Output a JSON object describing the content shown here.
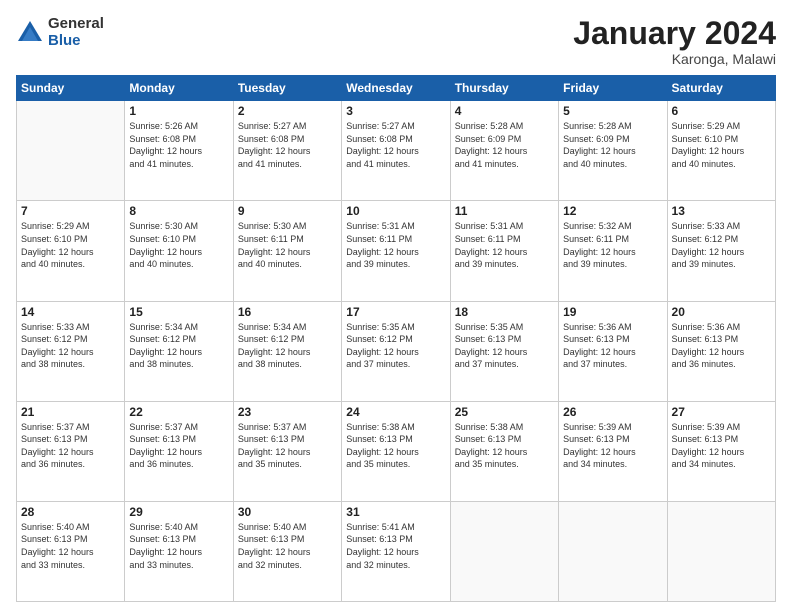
{
  "logo": {
    "general": "General",
    "blue": "Blue"
  },
  "title": "January 2024",
  "subtitle": "Karonga, Malawi",
  "days_header": [
    "Sunday",
    "Monday",
    "Tuesday",
    "Wednesday",
    "Thursday",
    "Friday",
    "Saturday"
  ],
  "weeks": [
    [
      {
        "day": "",
        "info": ""
      },
      {
        "day": "1",
        "info": "Sunrise: 5:26 AM\nSunset: 6:08 PM\nDaylight: 12 hours\nand 41 minutes."
      },
      {
        "day": "2",
        "info": "Sunrise: 5:27 AM\nSunset: 6:08 PM\nDaylight: 12 hours\nand 41 minutes."
      },
      {
        "day": "3",
        "info": "Sunrise: 5:27 AM\nSunset: 6:08 PM\nDaylight: 12 hours\nand 41 minutes."
      },
      {
        "day": "4",
        "info": "Sunrise: 5:28 AM\nSunset: 6:09 PM\nDaylight: 12 hours\nand 41 minutes."
      },
      {
        "day": "5",
        "info": "Sunrise: 5:28 AM\nSunset: 6:09 PM\nDaylight: 12 hours\nand 40 minutes."
      },
      {
        "day": "6",
        "info": "Sunrise: 5:29 AM\nSunset: 6:10 PM\nDaylight: 12 hours\nand 40 minutes."
      }
    ],
    [
      {
        "day": "7",
        "info": "Sunrise: 5:29 AM\nSunset: 6:10 PM\nDaylight: 12 hours\nand 40 minutes."
      },
      {
        "day": "8",
        "info": "Sunrise: 5:30 AM\nSunset: 6:10 PM\nDaylight: 12 hours\nand 40 minutes."
      },
      {
        "day": "9",
        "info": "Sunrise: 5:30 AM\nSunset: 6:11 PM\nDaylight: 12 hours\nand 40 minutes."
      },
      {
        "day": "10",
        "info": "Sunrise: 5:31 AM\nSunset: 6:11 PM\nDaylight: 12 hours\nand 39 minutes."
      },
      {
        "day": "11",
        "info": "Sunrise: 5:31 AM\nSunset: 6:11 PM\nDaylight: 12 hours\nand 39 minutes."
      },
      {
        "day": "12",
        "info": "Sunrise: 5:32 AM\nSunset: 6:11 PM\nDaylight: 12 hours\nand 39 minutes."
      },
      {
        "day": "13",
        "info": "Sunrise: 5:33 AM\nSunset: 6:12 PM\nDaylight: 12 hours\nand 39 minutes."
      }
    ],
    [
      {
        "day": "14",
        "info": "Sunrise: 5:33 AM\nSunset: 6:12 PM\nDaylight: 12 hours\nand 38 minutes."
      },
      {
        "day": "15",
        "info": "Sunrise: 5:34 AM\nSunset: 6:12 PM\nDaylight: 12 hours\nand 38 minutes."
      },
      {
        "day": "16",
        "info": "Sunrise: 5:34 AM\nSunset: 6:12 PM\nDaylight: 12 hours\nand 38 minutes."
      },
      {
        "day": "17",
        "info": "Sunrise: 5:35 AM\nSunset: 6:12 PM\nDaylight: 12 hours\nand 37 minutes."
      },
      {
        "day": "18",
        "info": "Sunrise: 5:35 AM\nSunset: 6:13 PM\nDaylight: 12 hours\nand 37 minutes."
      },
      {
        "day": "19",
        "info": "Sunrise: 5:36 AM\nSunset: 6:13 PM\nDaylight: 12 hours\nand 37 minutes."
      },
      {
        "day": "20",
        "info": "Sunrise: 5:36 AM\nSunset: 6:13 PM\nDaylight: 12 hours\nand 36 minutes."
      }
    ],
    [
      {
        "day": "21",
        "info": "Sunrise: 5:37 AM\nSunset: 6:13 PM\nDaylight: 12 hours\nand 36 minutes."
      },
      {
        "day": "22",
        "info": "Sunrise: 5:37 AM\nSunset: 6:13 PM\nDaylight: 12 hours\nand 36 minutes."
      },
      {
        "day": "23",
        "info": "Sunrise: 5:37 AM\nSunset: 6:13 PM\nDaylight: 12 hours\nand 35 minutes."
      },
      {
        "day": "24",
        "info": "Sunrise: 5:38 AM\nSunset: 6:13 PM\nDaylight: 12 hours\nand 35 minutes."
      },
      {
        "day": "25",
        "info": "Sunrise: 5:38 AM\nSunset: 6:13 PM\nDaylight: 12 hours\nand 35 minutes."
      },
      {
        "day": "26",
        "info": "Sunrise: 5:39 AM\nSunset: 6:13 PM\nDaylight: 12 hours\nand 34 minutes."
      },
      {
        "day": "27",
        "info": "Sunrise: 5:39 AM\nSunset: 6:13 PM\nDaylight: 12 hours\nand 34 minutes."
      }
    ],
    [
      {
        "day": "28",
        "info": "Sunrise: 5:40 AM\nSunset: 6:13 PM\nDaylight: 12 hours\nand 33 minutes."
      },
      {
        "day": "29",
        "info": "Sunrise: 5:40 AM\nSunset: 6:13 PM\nDaylight: 12 hours\nand 33 minutes."
      },
      {
        "day": "30",
        "info": "Sunrise: 5:40 AM\nSunset: 6:13 PM\nDaylight: 12 hours\nand 32 minutes."
      },
      {
        "day": "31",
        "info": "Sunrise: 5:41 AM\nSunset: 6:13 PM\nDaylight: 12 hours\nand 32 minutes."
      },
      {
        "day": "",
        "info": ""
      },
      {
        "day": "",
        "info": ""
      },
      {
        "day": "",
        "info": ""
      }
    ]
  ]
}
